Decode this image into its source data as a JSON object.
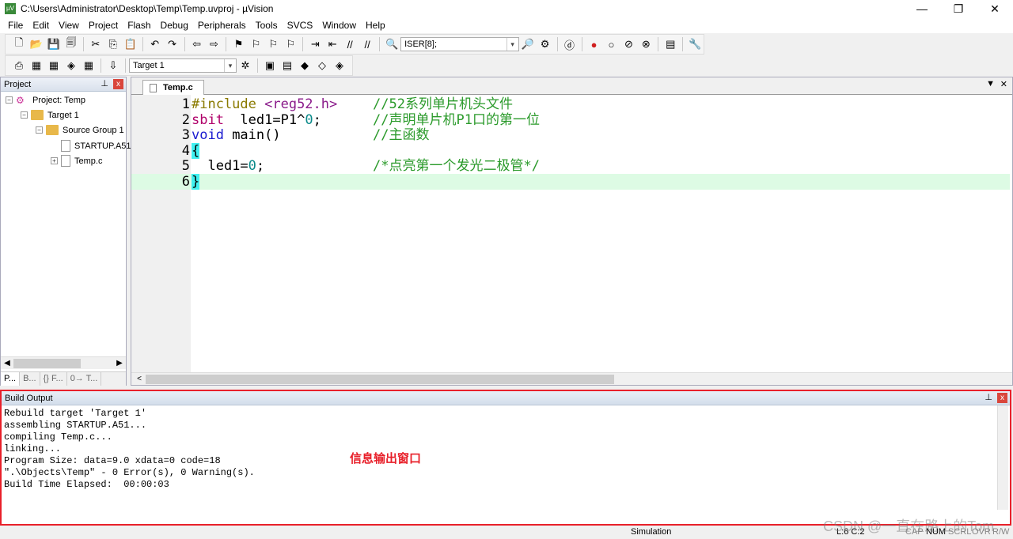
{
  "window": {
    "title": "C:\\Users\\Administrator\\Desktop\\Temp\\Temp.uvproj - µVision",
    "app_icon": "uvision-icon",
    "controls": [
      "—",
      "❐",
      "✕"
    ]
  },
  "menu": [
    "File",
    "Edit",
    "View",
    "Project",
    "Flash",
    "Debug",
    "Peripherals",
    "Tools",
    "SVCS",
    "Window",
    "Help"
  ],
  "toolbar1": {
    "find_combo": "ISER[8];"
  },
  "toolbar2": {
    "target_combo": "Target 1"
  },
  "project_panel": {
    "title": "Project",
    "tree": [
      {
        "label": "Project: Temp",
        "level": 0
      },
      {
        "label": "Target 1",
        "level": 1
      },
      {
        "label": "Source Group 1",
        "level": 2
      },
      {
        "label": "STARTUP.A51",
        "level": 3
      },
      {
        "label": "Temp.c",
        "level": 3
      }
    ],
    "tabs": [
      "P...",
      "B...",
      "{} F...",
      "0→ T..."
    ]
  },
  "editor": {
    "tab": "Temp.c",
    "lines": [
      {
        "n": "1",
        "parts": [
          [
            "pp",
            "#include "
          ],
          [
            "inc",
            "<reg52.h>"
          ]
        ],
        "comment": "//52系列单片机头文件"
      },
      {
        "n": "2",
        "parts": [
          [
            "kw",
            "sbit"
          ],
          [
            "",
            "  led1=P1^"
          ],
          [
            "num",
            "0"
          ],
          [
            "",
            ";"
          ]
        ],
        "comment": "//声明单片机P1口的第一位"
      },
      {
        "n": "3",
        "parts": [
          [
            "bl",
            "void"
          ],
          [
            "",
            " main()"
          ]
        ],
        "comment": "//主函数"
      },
      {
        "n": "4",
        "parts": [
          [
            "brace",
            "{"
          ]
        ],
        "comment": ""
      },
      {
        "n": "5",
        "parts": [
          [
            "",
            "  led1="
          ],
          [
            "num",
            "0"
          ],
          [
            "",
            ";"
          ]
        ],
        "comment": "/*点亮第一个发光二极管*/"
      },
      {
        "n": "6",
        "parts": [
          [
            "brace",
            "}"
          ]
        ],
        "comment": ""
      }
    ]
  },
  "build_output": {
    "title": "Build Output",
    "lines": [
      "Rebuild target 'Target 1'",
      "assembling STARTUP.A51...",
      "compiling Temp.c...",
      "linking...",
      "Program Size: data=9.0 xdata=0 code=18",
      "\".\\Objects\\Temp\" - 0 Error(s), 0 Warning(s).",
      "Build Time Elapsed:  00:00:03"
    ],
    "annotation": "信息输出窗口"
  },
  "status": {
    "mode": "Simulation",
    "position": "L:6 C:2",
    "caps": "CAP",
    "num": "NUM",
    "scrl": "SCRL",
    "ovr": "OVR",
    "rw": "R/W"
  },
  "watermark": "CSDN @一直在路上的Tom",
  "colors": {
    "highlight": "#e8202a",
    "current_line": "#ddfbe4",
    "comment": "#2a9a2a"
  }
}
